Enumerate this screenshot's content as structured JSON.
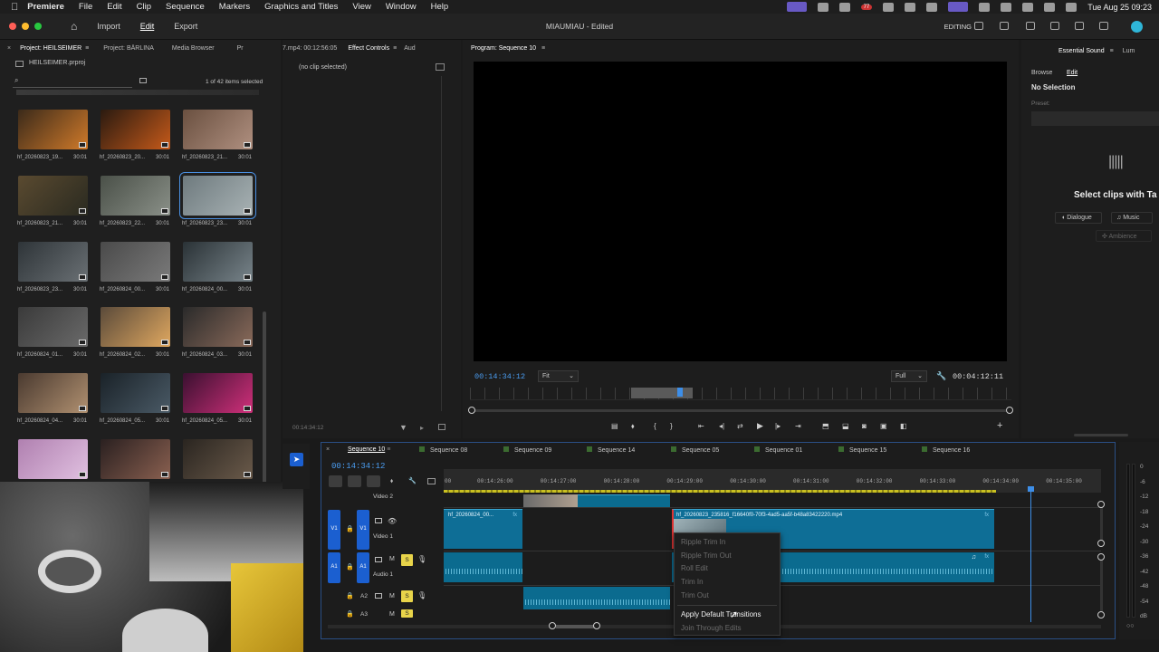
{
  "menubar": {
    "app": "Premiere",
    "items": [
      "File",
      "Edit",
      "Clip",
      "Sequence",
      "Markers",
      "Graphics and Titles",
      "View",
      "Window",
      "Help"
    ],
    "badge_count": "77",
    "clock": "Tue Aug 25  09:23"
  },
  "header": {
    "nav": [
      "Import",
      "Edit",
      "Export"
    ],
    "active_nav": "Edit",
    "title": "MIAUMIAU - Edited",
    "workspace": "EDITING"
  },
  "project_panel": {
    "tabs": [
      "Project: HEILSEIMER",
      "Project: BÄRLINA",
      "Media Browser",
      "Pr"
    ],
    "file": "HEILSEIMER.prproj",
    "selection_count": "1 of 42 items selected",
    "clips": [
      {
        "name": "hf_20260823_19...",
        "duration": "30:01"
      },
      {
        "name": "hf_20260823_20...",
        "duration": "30:01"
      },
      {
        "name": "hf_20260823_21...",
        "duration": "30:01"
      },
      {
        "name": "hf_20260823_21...",
        "duration": "30:01"
      },
      {
        "name": "hf_20260823_22...",
        "duration": "30:01"
      },
      {
        "name": "hf_20260823_23...",
        "duration": "30:01"
      },
      {
        "name": "hf_20260823_23...",
        "duration": "30:01"
      },
      {
        "name": "hf_20260824_00...",
        "duration": "30:01"
      },
      {
        "name": "hf_20260824_00...",
        "duration": "30:01"
      },
      {
        "name": "hf_20260824_01...",
        "duration": "30:01"
      },
      {
        "name": "hf_20260824_02...",
        "duration": "30:01"
      },
      {
        "name": "hf_20260824_03...",
        "duration": "30:01"
      },
      {
        "name": "hf_20260824_04...",
        "duration": "30:01"
      },
      {
        "name": "hf_20260824_05...",
        "duration": "30:01"
      },
      {
        "name": "hf_20260824_05...",
        "duration": "30:01"
      }
    ]
  },
  "effect_controls": {
    "tabs": [
      "7.mp4: 00:12:56:05",
      "Effect Controls",
      "Aud"
    ],
    "empty_text": "(no clip selected)",
    "timecode": "00:14:34:12"
  },
  "program_monitor": {
    "tab": "Program: Sequence 10",
    "timecode": "00:14:34:12",
    "fit": "Fit",
    "resolution": "Full",
    "duration": "00:04:12:11"
  },
  "essential_sound": {
    "tabs": [
      "Essential Sound",
      "Lum"
    ],
    "subtabs": [
      "Browse",
      "Edit"
    ],
    "no_selection": "No Selection",
    "preset_label": "Preset:",
    "prompt": "Select clips with Ta",
    "buttons": [
      "Dialogue",
      "Music",
      "Ambience"
    ]
  },
  "timeline": {
    "sequences": [
      "Sequence 10",
      "Sequence 08",
      "Sequence 09",
      "Sequence 14",
      "Sequence 05",
      "Sequence 01",
      "Sequence 15",
      "Sequence 16"
    ],
    "timecode": "00:14:34:12",
    "ruler": [
      "00:14:26:00",
      "00:14:27:00",
      "00:14:28:00",
      "00:14:29:00",
      "00:14:30:00",
      "00:14:31:00",
      "00:14:32:00",
      "00:14:33:00",
      "00:14:34:00",
      "00:14:35:00"
    ],
    "ruler_first": "00",
    "tracks": {
      "video2": "Video 2",
      "video1": "Video 1",
      "audio1": "Audio 1",
      "v1": "V1",
      "a1": "A1",
      "a2": "A2",
      "a3": "A3",
      "m": "M",
      "s": "S"
    },
    "clip1": "hf_20260824_00...",
    "clip2": "hf_20260823_235816_f16640f0-70f3-4ad5-aa5f-b48a83422220.mp4",
    "fx": "fx"
  },
  "context_menu": {
    "items": [
      "Ripple Trim In",
      "Ripple Trim Out",
      "Roll Edit",
      "Trim In",
      "Trim Out",
      "Apply Default Transitions",
      "Join Through Edits"
    ],
    "enabled": "Apply Default Transitions"
  },
  "meter": {
    "labels": [
      "0",
      "-6",
      "-12",
      "-18",
      "-24",
      "-30",
      "-36",
      "-42",
      "-48",
      "-54",
      "dB"
    ]
  },
  "colors": {
    "accent_blue": "#1b5fd0",
    "clip_teal": "#0e6e96",
    "solo_yellow": "#e8d44a",
    "marker_green": "#3b6b30"
  }
}
